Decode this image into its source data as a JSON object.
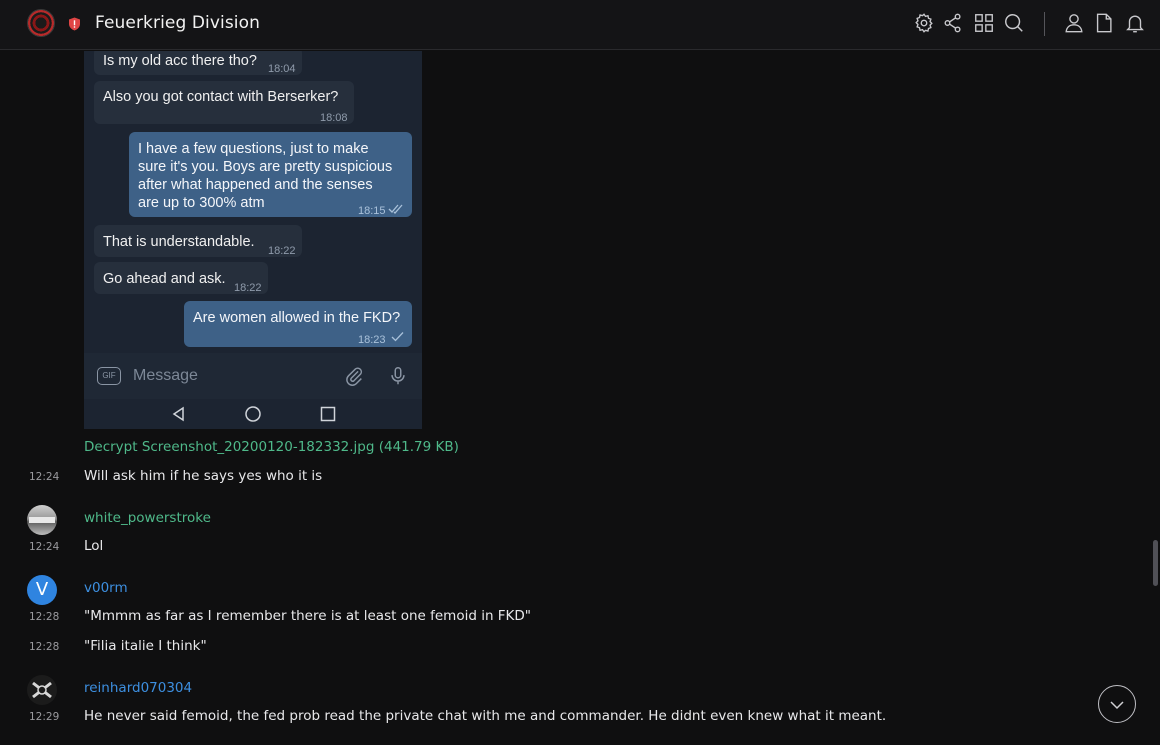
{
  "header": {
    "title": "Feuerkrieg Division",
    "icons": [
      "settings-icon",
      "share-icon",
      "grid-icon",
      "search-icon",
      "user-icon",
      "file-icon",
      "bell-icon"
    ]
  },
  "attachment": {
    "bubbles": [
      {
        "dir": "in",
        "text": "Is my old acc there tho?",
        "time": "18:04"
      },
      {
        "dir": "in",
        "text": "Also you got contact with Berserker?",
        "time": "18:08"
      },
      {
        "dir": "out",
        "lines": [
          "I have a few questions, just to make",
          "sure it's you. Boys are pretty suspicious",
          "after what happened and the senses",
          "are up to 300% atm"
        ],
        "time": "18:15"
      },
      {
        "dir": "in",
        "text": "That is understandable.",
        "time": "18:22"
      },
      {
        "dir": "in",
        "text": "Go ahead and ask.",
        "time": "18:22"
      },
      {
        "dir": "out",
        "text": "Are women allowed in the FKD?",
        "time": "18:23"
      }
    ],
    "composer_placeholder": "Message",
    "gif_label": "GIF",
    "file_link": "Decrypt Screenshot_20200120-182332.jpg (441.79 KB)"
  },
  "messages": [
    {
      "time": "12:24",
      "text": "Will ask him if he says yes who it is"
    },
    {
      "sender": "white_powerstroke",
      "sender_color": "#4fb98a",
      "time": "12:24",
      "text": "Lol"
    },
    {
      "sender": "v00rm",
      "sender_color": "#3d8fe0",
      "avatar_letter": "V",
      "time": "12:28",
      "text": "\"Mmmm as far as I remember there is at least one femoid in FKD\""
    },
    {
      "time": "12:28",
      "text": "\"Filia italie I think\""
    },
    {
      "sender": "reinhard070304",
      "sender_color": "#3d8fe0",
      "time": "12:29",
      "text": "He never said femoid, the fed prob read the private chat with me and commander. He didnt even knew what it meant."
    }
  ]
}
